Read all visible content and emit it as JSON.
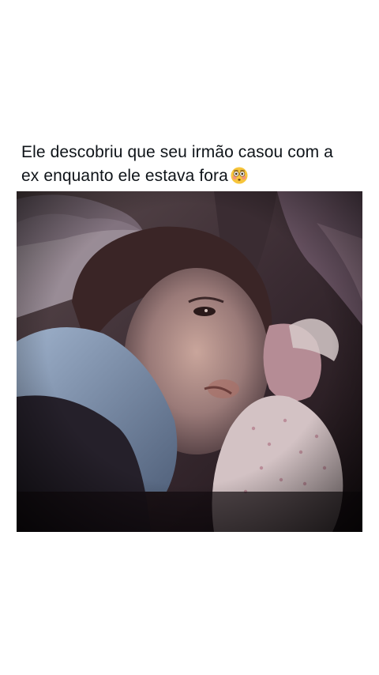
{
  "post": {
    "text_line1": "Ele descobriu que seu irmão casou com a",
    "text_line2": "ex enquanto ele estava fora",
    "emoji": "flushed-face-emoji"
  },
  "media": {
    "kind": "video-frame",
    "subject": "child-lying-in-bed-photo"
  },
  "colors": {
    "text": "#0f1419",
    "background": "#ffffff",
    "emoji_face": "#f7c53b",
    "emoji_cheeks": "#f28b82"
  }
}
